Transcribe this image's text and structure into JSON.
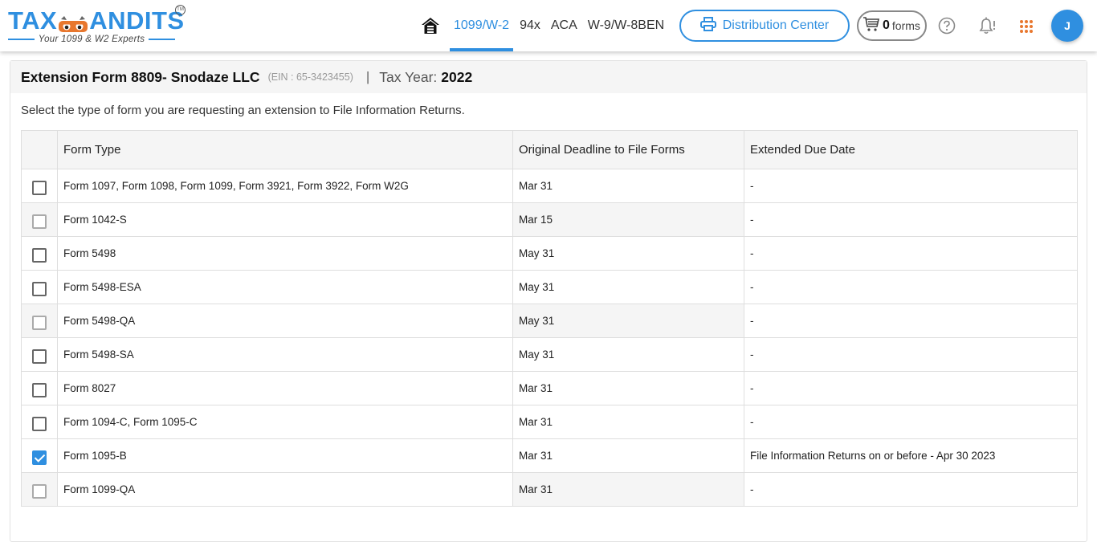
{
  "brand": {
    "name_left": "TAX",
    "name_right": "ANDITS",
    "trademark": "TM",
    "tagline": "Your 1099 & W2 Experts",
    "primary_color": "#2f8fe0",
    "accent_color": "#e8772e"
  },
  "nav": {
    "home_icon": "home-icon",
    "items": [
      {
        "label": "1099/W-2",
        "active": true
      },
      {
        "label": "94x",
        "active": false
      },
      {
        "label": "ACA",
        "active": false
      },
      {
        "label": "W-9/W-8BEN",
        "active": false
      }
    ]
  },
  "toolbar": {
    "distribution_center_label": "Distribution Center",
    "cart_count": "0",
    "cart_label": "forms",
    "avatar_initial": "J"
  },
  "page": {
    "title": "Extension Form 8809- Snodaze LLC",
    "ein": "(EIN : 65-3423455)",
    "separator": "|",
    "tax_year_label": "Tax Year:",
    "tax_year": "2022",
    "instruction": "Select the type of form you are requesting an extension to File Information Returns."
  },
  "table": {
    "headers": [
      "",
      "Form Type",
      "Original Deadline to File Forms",
      "Extended Due Date"
    ],
    "rows": [
      {
        "form_type": "Form 1097, Form 1098, Form 1099, Form 3921, Form 3922, Form W2G",
        "original_deadline": "Mar 31",
        "extended_due": "-",
        "checked": false,
        "disabled": false
      },
      {
        "form_type": "Form 1042-S",
        "original_deadline": "Mar 15",
        "extended_due": "-",
        "checked": false,
        "disabled": true
      },
      {
        "form_type": "Form 5498",
        "original_deadline": "May 31",
        "extended_due": "-",
        "checked": false,
        "disabled": false
      },
      {
        "form_type": "Form 5498-ESA",
        "original_deadline": "May 31",
        "extended_due": "-",
        "checked": false,
        "disabled": false
      },
      {
        "form_type": "Form 5498-QA",
        "original_deadline": "May 31",
        "extended_due": "-",
        "checked": false,
        "disabled": true
      },
      {
        "form_type": "Form 5498-SA",
        "original_deadline": "May 31",
        "extended_due": "-",
        "checked": false,
        "disabled": false
      },
      {
        "form_type": "Form 8027",
        "original_deadline": "Mar 31",
        "extended_due": "-",
        "checked": false,
        "disabled": false
      },
      {
        "form_type": "Form 1094-C, Form 1095-C",
        "original_deadline": "Mar 31",
        "extended_due": "-",
        "checked": false,
        "disabled": false
      },
      {
        "form_type": "Form 1095-B",
        "original_deadline": "Mar 31",
        "extended_due": "File Information Returns on or before - Apr 30 2023",
        "checked": true,
        "disabled": false
      },
      {
        "form_type": "Form 1099-QA",
        "original_deadline": "Mar 31",
        "extended_due": "-",
        "checked": false,
        "disabled": true
      }
    ]
  }
}
